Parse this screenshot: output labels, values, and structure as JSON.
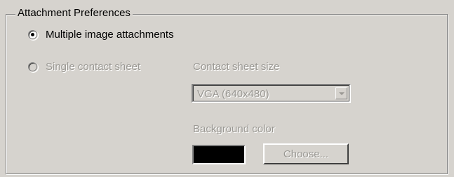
{
  "group": {
    "title": "Attachment Preferences"
  },
  "options": {
    "multiple": {
      "label": "Multiple image attachments",
      "selected": true
    },
    "single": {
      "label": "Single contact sheet",
      "selected": false,
      "enabled": false
    }
  },
  "contact_sheet_size": {
    "label": "Contact sheet size",
    "value": "VGA (640x480)"
  },
  "background_color": {
    "label": "Background color",
    "color": "#000000",
    "button_label": "Choose..."
  }
}
